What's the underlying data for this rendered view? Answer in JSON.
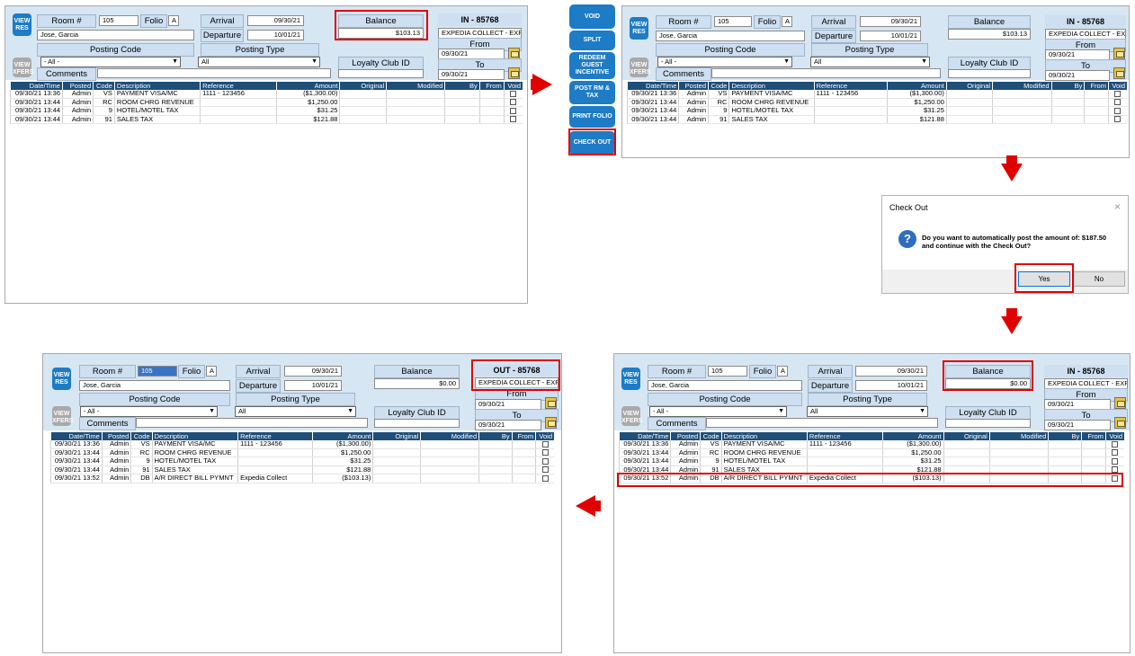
{
  "labels": {
    "view_res": "VIEW RES",
    "view_xfers": "VIEW XFERS",
    "room": "Room #",
    "folio": "Folio",
    "arrival": "Arrival",
    "departure": "Departure",
    "balance": "Balance",
    "posting_code": "Posting Code",
    "posting_type": "Posting Type",
    "loyalty": "Loyalty Club ID",
    "comments": "Comments",
    "from": "From",
    "to": "To"
  },
  "values": {
    "room": "105",
    "folio": "A",
    "guest": "Jose, Garcia",
    "arrival": "09/30/21",
    "departure": "10/01/21",
    "posting_code": "- All -",
    "posting_type": "All",
    "company": "EXPEDIA COLLECT - EXPI",
    "from": "09/30/21",
    "to": "09/30/21"
  },
  "columns": [
    "Date/Time",
    "Posted",
    "Code",
    "Description",
    "Reference",
    "Amount",
    "Original",
    "Modified",
    "By",
    "From",
    "Void"
  ],
  "rows": [
    [
      "09/30/21 13:36",
      "Admin",
      "VS",
      "PAYMENT VISA/MC",
      "1111 - 123456",
      "($1,300.00)"
    ],
    [
      "09/30/21 13:44",
      "Admin",
      "RC",
      "ROOM CHRG REVENUE",
      "",
      "$1,250.00"
    ],
    [
      "09/30/21 13:44",
      "Admin",
      "9",
      "HOTEL/MOTEL TAX",
      "",
      "$31.25"
    ],
    [
      "09/30/21 13:44",
      "Admin",
      "91",
      "SALES TAX",
      "",
      "$121.88"
    ]
  ],
  "new_row": [
    "09/30/21 13:52",
    "Admin",
    "DB",
    "A/R DIRECT BILL PYMNT",
    "Expedia Collect",
    "($103.13)"
  ],
  "panels": [
    {
      "status": "IN - 85768",
      "balance": "$103.13"
    },
    {
      "status": "IN - 85768",
      "balance": "$103.13"
    },
    {
      "status": "IN - 85768",
      "balance": "$0.00"
    },
    {
      "status": "OUT - 85768",
      "balance": "$0.00"
    }
  ],
  "side_buttons": [
    "VOID",
    "SPLIT",
    "REDEEM GUEST INCENTIVE",
    "POST RM & TAX",
    "PRINT FOLIO",
    "CHECK OUT"
  ],
  "dialog": {
    "title": "Check Out",
    "close": "×",
    "message_line1": "Do you want to automatically post the amount of: $187.50",
    "message_line2": "and continue with the Check Out?",
    "yes": "Yes",
    "no": "No"
  },
  "colors": {
    "accent": "#1e7bc5",
    "highlight": "#e00000",
    "grid_header": "#1f4e79"
  }
}
